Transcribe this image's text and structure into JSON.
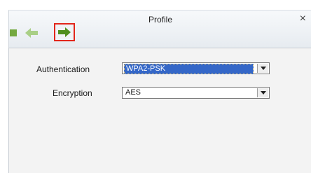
{
  "window": {
    "title": "Profile",
    "close_glyph": "×"
  },
  "toolbar": {
    "stop_icon": "stop-icon",
    "back_icon": "back-arrow-icon",
    "forward_icon": "forward-arrow-icon",
    "back_color": "#a9cf86",
    "forward_color": "#4f8f1e",
    "highlight_color": "#e2261b"
  },
  "form": {
    "authentication": {
      "label": "Authentication",
      "value": "WPA2-PSK"
    },
    "encryption": {
      "label": "Encryption",
      "value": "AES"
    }
  }
}
